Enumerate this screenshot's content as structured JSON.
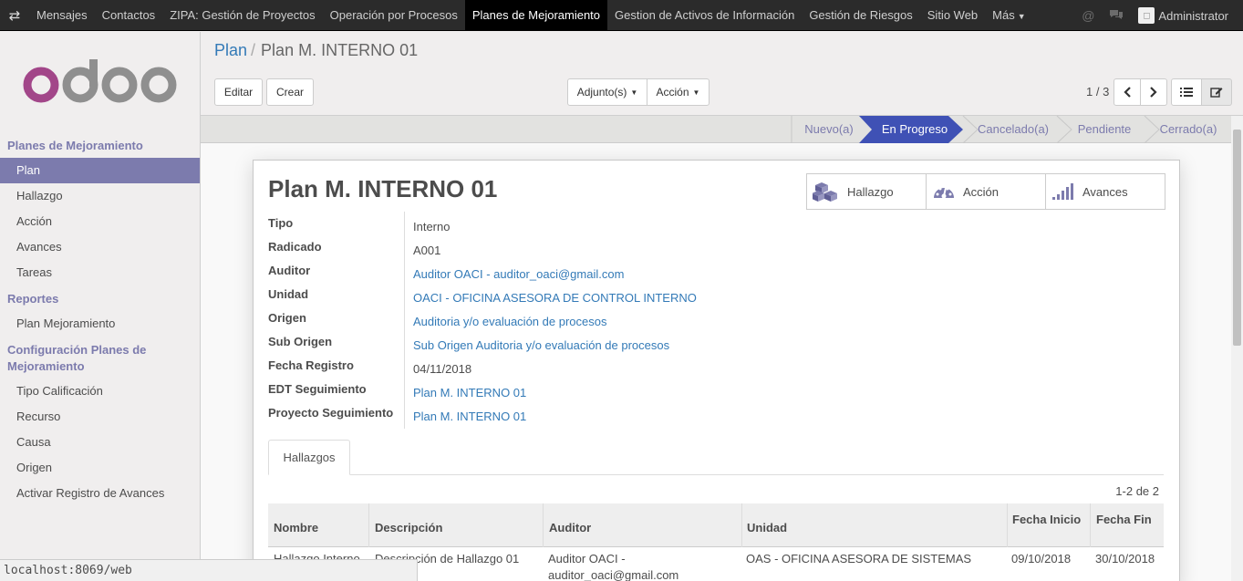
{
  "topbar": {
    "menu": [
      "Mensajes",
      "Contactos",
      "ZIPA: Gestión de Proyectos",
      "Operación por Procesos",
      "Planes de Mejoramiento",
      "Gestion de Activos de Información",
      "Gestión de Riesgos",
      "Sitio Web"
    ],
    "more_label": "Más",
    "active_index": 4,
    "user": "Administrator"
  },
  "sidebar": {
    "section1": "Planes de Mejoramiento",
    "items1": [
      "Plan",
      "Hallazgo",
      "Acción",
      "Avances",
      "Tareas"
    ],
    "section2": "Reportes",
    "items2": [
      "Plan Mejoramiento"
    ],
    "section3": "Configuración Planes de Mejoramiento",
    "items3": [
      "Tipo Calificación",
      "Recurso",
      "Causa",
      "Origen",
      "Activar Registro de Avances"
    ]
  },
  "breadcrumb": {
    "parent": "Plan",
    "current": "Plan M. INTERNO 01"
  },
  "buttons": {
    "edit": "Editar",
    "create": "Crear",
    "attachments": "Adjunto(s)",
    "action": "Acción"
  },
  "pager": "1 / 3",
  "stages": [
    "Nuevo(a)",
    "En Progreso",
    "Cancelado(a)",
    "Pendiente",
    "Cerrado(a)"
  ],
  "active_stage": "En Progreso",
  "form": {
    "title": "Plan M. INTERNO 01",
    "smart_buttons": [
      "Hallazgo",
      "Acción",
      "Avances"
    ],
    "fields": [
      {
        "label": "Tipo",
        "value": "Interno"
      },
      {
        "label": "Radicado",
        "value": "A001"
      },
      {
        "label": "Auditor",
        "value": "Auditor OACI - auditor_oaci@gmail.com"
      },
      {
        "label": "Unidad",
        "value": "OACI - OFICINA ASESORA DE CONTROL INTERNO"
      },
      {
        "label": "Origen",
        "value": "Auditoria y/o evaluación de procesos"
      },
      {
        "label": "Sub Origen",
        "value": "Sub Origen Auditoria y/o evaluación de procesos"
      },
      {
        "label": "Fecha Registro",
        "value": "04/11/2018"
      },
      {
        "label": "EDT Seguimiento",
        "value": "Plan M. INTERNO 01"
      },
      {
        "label": "Proyecto Seguimiento",
        "value": "Plan M. INTERNO 01"
      }
    ],
    "tab": "Hallazgos",
    "list_pager": "1-2 de 2",
    "columns": [
      "Nombre",
      "Descripción",
      "Auditor",
      "Unidad",
      "Fecha Inicio",
      "Fecha Fin"
    ],
    "rows": [
      {
        "nombre": "Hallazgo Interno",
        "descripcion": "Descripción de Hallazgo 01",
        "auditor": "Auditor OACI - auditor_oaci@gmail.com",
        "unidad": "OAS - OFICINA ASESORA DE SISTEMAS",
        "inicio": "09/10/2018",
        "fin": "30/10/2018"
      }
    ]
  },
  "status_url": "localhost:8069/web",
  "colors": {
    "accent": "#7c7bad",
    "link": "#337ab7",
    "stage_active": "#3f51b5"
  }
}
